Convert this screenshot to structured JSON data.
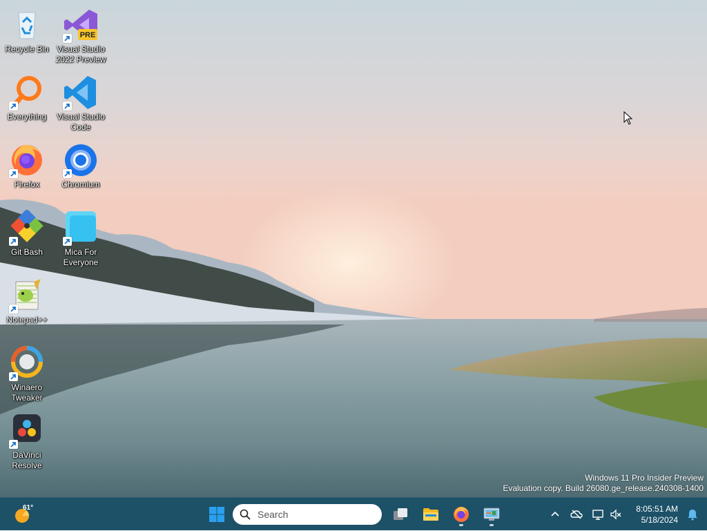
{
  "desktop": {
    "icons": [
      {
        "id": "recycle-bin",
        "label": "Recycle Bin",
        "shortcut": false,
        "icon": "recycle-bin-icon"
      },
      {
        "id": "visual-studio-2022-preview",
        "label": "Visual Studio 2022 Preview",
        "shortcut": true,
        "icon": "visual-studio-preview-icon",
        "badge": "PRE"
      },
      {
        "id": "everything",
        "label": "Everything",
        "shortcut": true,
        "icon": "magnifier-orange-icon"
      },
      {
        "id": "visual-studio-code",
        "label": "Visual Studio Code",
        "shortcut": true,
        "icon": "vscode-icon"
      },
      {
        "id": "firefox",
        "label": "Firefox",
        "shortcut": true,
        "icon": "firefox-icon"
      },
      {
        "id": "chromium",
        "label": "Chromium",
        "shortcut": true,
        "icon": "chromium-icon"
      },
      {
        "id": "git-bash",
        "label": "Git Bash",
        "shortcut": true,
        "icon": "git-bash-icon"
      },
      {
        "id": "mica-for-everyone",
        "label": "Mica For Everyone",
        "shortcut": true,
        "icon": "mica-icon"
      },
      {
        "id": "notepad-plus-plus",
        "label": "Notepad++",
        "shortcut": true,
        "icon": "notepad-plus-plus-icon"
      },
      {
        "id": "winaero-tweaker",
        "label": "Winaero Tweaker",
        "shortcut": true,
        "icon": "winaero-tweaker-icon"
      },
      {
        "id": "davinci-resolve",
        "label": "DaVinci Resolve",
        "shortcut": true,
        "icon": "davinci-resolve-icon"
      }
    ]
  },
  "watermark": {
    "line1": "Windows 11 Pro Insider Preview",
    "line2": "Evaluation copy. Build 26080.ge_release.240308-1400"
  },
  "taskbar": {
    "weather": {
      "temp": "61°",
      "icon": "weather-sun-icon"
    },
    "start": {
      "icon": "windows-start-icon"
    },
    "search": {
      "placeholder": "Search"
    },
    "apps": [
      {
        "name": "task-view",
        "icon": "task-view-icon",
        "running": false
      },
      {
        "name": "file-explorer",
        "icon": "folder-icon",
        "running": false
      },
      {
        "name": "firefox",
        "icon": "firefox-icon",
        "running": true
      },
      {
        "name": "control-panel",
        "icon": "control-panel-icon",
        "running": true
      }
    ],
    "tray": {
      "icons": [
        "chevron-up-icon",
        "onedrive-offline-icon",
        "network-icon",
        "volume-muted-icon",
        "notification-bell-icon"
      ]
    },
    "clock": {
      "time": "8:05:51 AM",
      "date": "5/18/2024"
    }
  },
  "colors": {
    "taskbar": "#1d5167",
    "accent": "#0078d4"
  }
}
